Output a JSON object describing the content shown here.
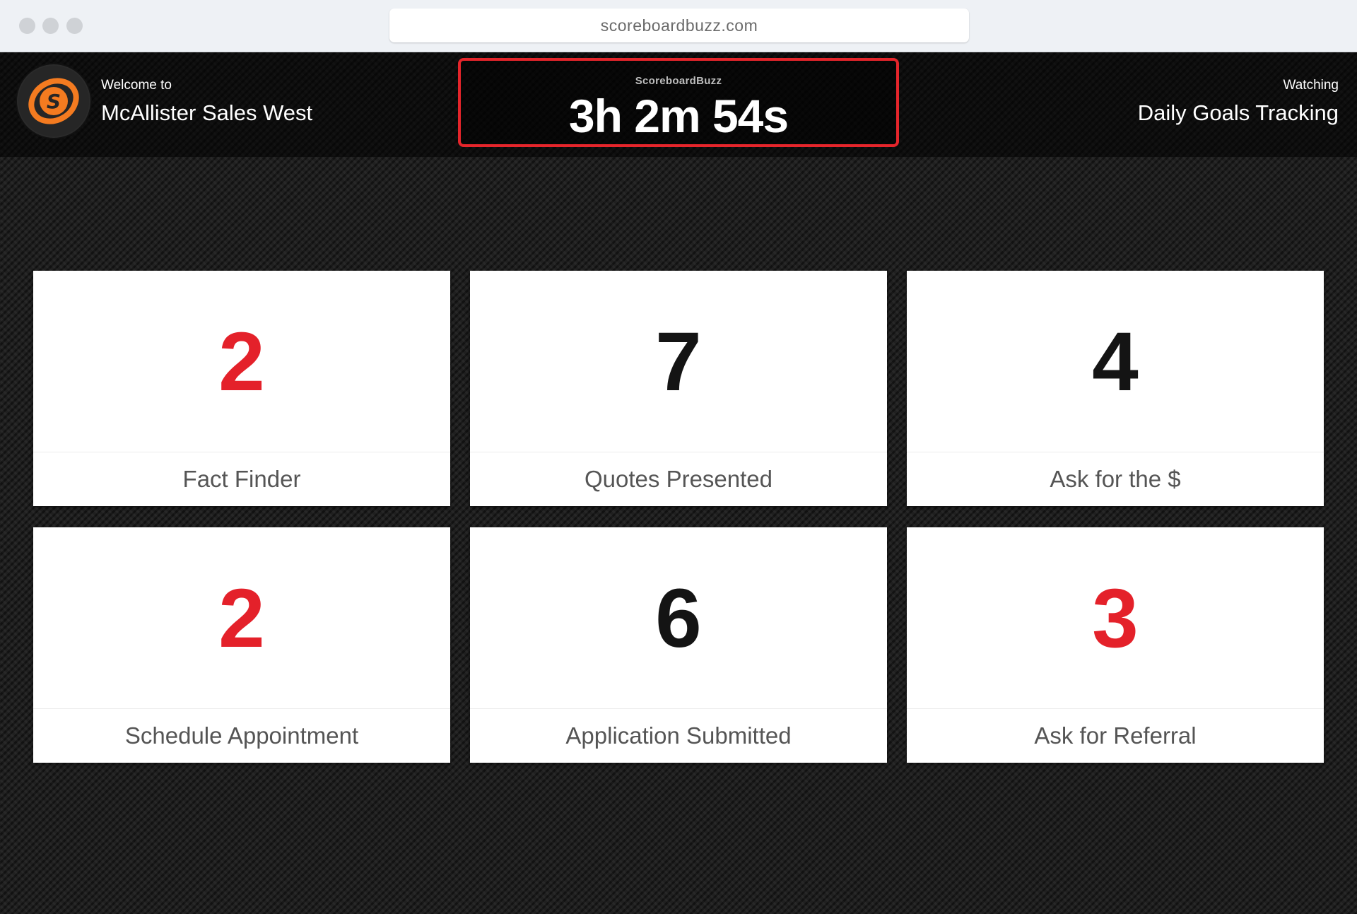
{
  "browser": {
    "url": "scoreboardbuzz.com"
  },
  "header": {
    "welcome_label": "Welcome to",
    "organization": "McAllister Sales West",
    "timer_brand": "ScoreboardBuzz",
    "timer_value": "3h 2m 54s",
    "watching_label": "Watching",
    "board_name": "Daily Goals Tracking",
    "logo_icon": "scoreboardbuzz-s-logo-icon"
  },
  "colors": {
    "accent_red": "#e4212a",
    "logo_orange": "#f47b20",
    "value_dark": "#141414"
  },
  "tiles": [
    {
      "value": "2",
      "label": "Fact Finder",
      "status": "below-goal"
    },
    {
      "value": "7",
      "label": "Quotes Presented",
      "status": "normal"
    },
    {
      "value": "4",
      "label": "Ask for the $",
      "status": "normal"
    },
    {
      "value": "2",
      "label": "Schedule Appointment",
      "status": "below-goal"
    },
    {
      "value": "6",
      "label": "Application Submitted",
      "status": "normal"
    },
    {
      "value": "3",
      "label": "Ask for Referral",
      "status": "below-goal"
    }
  ]
}
